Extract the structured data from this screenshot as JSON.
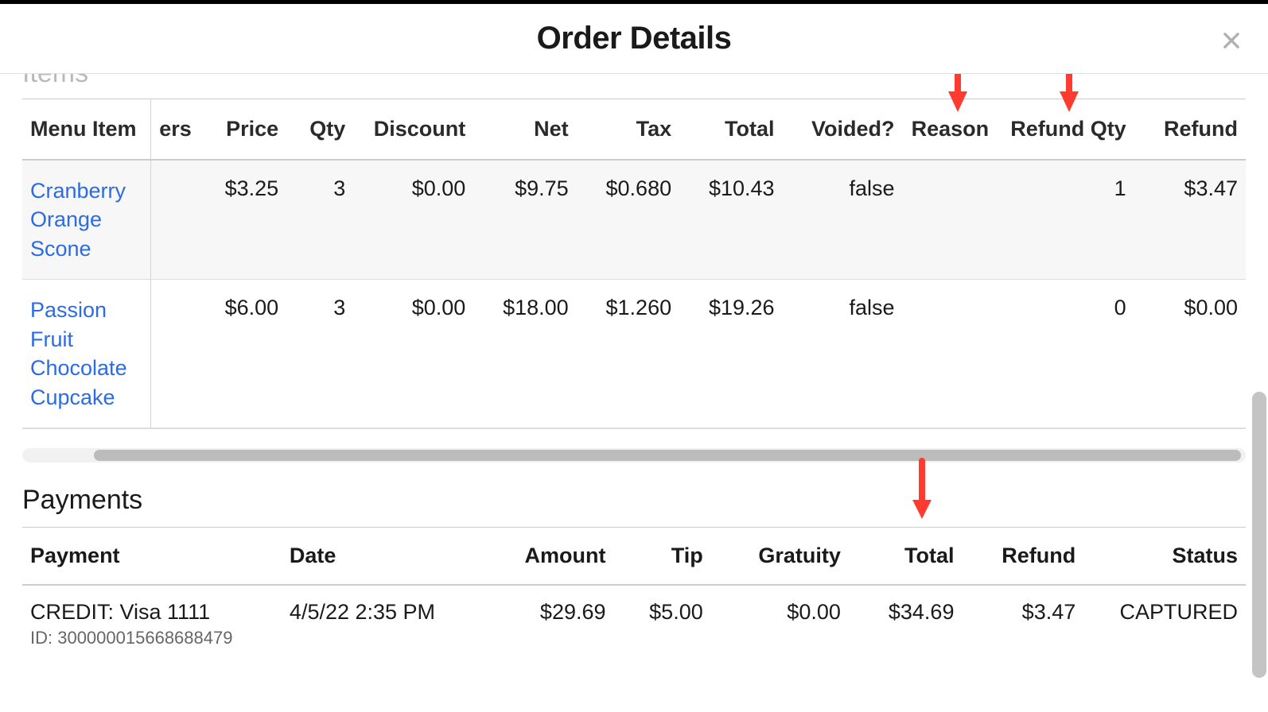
{
  "modal": {
    "title": "Order Details"
  },
  "items_section": {
    "title": "Items",
    "headers": {
      "menu_item": "Menu Item",
      "ers": "ers",
      "price": "Price",
      "qty": "Qty",
      "discount": "Discount",
      "net": "Net",
      "tax": "Tax",
      "total": "Total",
      "voided": "Voided?",
      "reason": "Reason",
      "refund_qty": "Refund Qty",
      "refund": "Refund"
    },
    "rows": [
      {
        "name": "Cranberry Orange Scone",
        "price": "$3.25",
        "qty": "3",
        "discount": "$0.00",
        "net": "$9.75",
        "tax": "$0.680",
        "total": "$10.43",
        "voided": "false",
        "reason": "",
        "refund_qty": "1",
        "refund": "$3.47"
      },
      {
        "name": "Passion Fruit Chocolate Cupcake",
        "price": "$6.00",
        "qty": "3",
        "discount": "$0.00",
        "net": "$18.00",
        "tax": "$1.260",
        "total": "$19.26",
        "voided": "false",
        "reason": "",
        "refund_qty": "0",
        "refund": "$0.00"
      }
    ]
  },
  "payments_section": {
    "title": "Payments",
    "headers": {
      "payment": "Payment",
      "date": "Date",
      "amount": "Amount",
      "tip": "Tip",
      "gratuity": "Gratuity",
      "total": "Total",
      "refund": "Refund",
      "status": "Status"
    },
    "rows": [
      {
        "payment": "CREDIT: Visa 1111",
        "id_label": "ID: 300000015668688479",
        "date": "4/5/22 2:35 PM",
        "amount": "$29.69",
        "tip": "$5.00",
        "gratuity": "$0.00",
        "total": "$34.69",
        "refund": "$3.47",
        "status": "CAPTURED"
      }
    ]
  }
}
